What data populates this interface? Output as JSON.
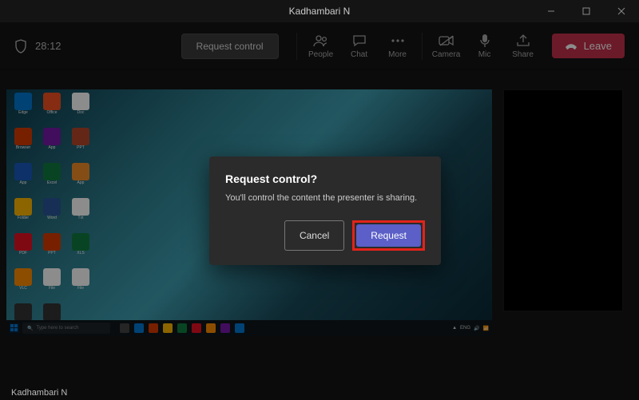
{
  "window": {
    "title": "Kadhambari N"
  },
  "timer": "28:12",
  "toolbar": {
    "request_control_label": "Request control",
    "people": "People",
    "chat": "Chat",
    "more": "More",
    "camera": "Camera",
    "mic": "Mic",
    "share": "Share",
    "leave": "Leave"
  },
  "dialog": {
    "title": "Request control?",
    "body": "You'll control the content the presenter is sharing.",
    "cancel": "Cancel",
    "confirm": "Request"
  },
  "taskbar": {
    "search_placeholder": "Type here to search"
  },
  "bottom_name": "Kadhambari N",
  "icons": {
    "shield": "shield",
    "people": "people",
    "chat": "chat",
    "more": "more",
    "camera": "camera-off",
    "mic": "mic",
    "share": "share-tray",
    "hangup": "hangup"
  },
  "colors": {
    "leave": "#c4314b",
    "confirm": "#5b5fc7",
    "highlight": "#e2231a"
  }
}
